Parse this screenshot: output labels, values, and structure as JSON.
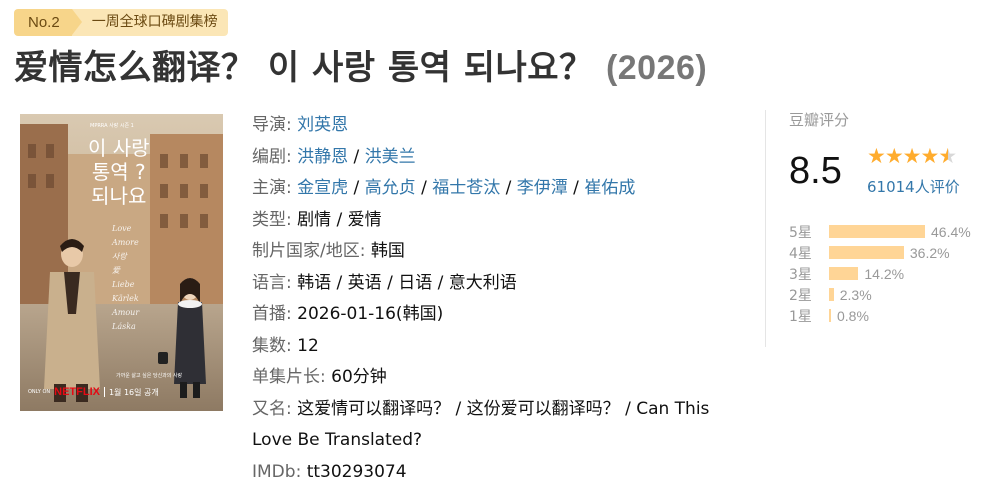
{
  "badge": {
    "rank": "No.2",
    "text": "一周全球口碑剧集榜"
  },
  "title": {
    "main": "爱情怎么翻译？ 이 사랑 통역 되나요？",
    "year": "(2026)"
  },
  "poster": {
    "top_text": "MPRRA 사랑 시즌 1",
    "korean_title": [
      "이 사랑",
      "통역 ?",
      "되나요"
    ],
    "script_words": [
      "Love",
      "Amore",
      "사랑",
      "爱",
      "Liebe",
      "Kärlek",
      "Amour",
      "Láska"
    ],
    "tagline": "가까운 삶고 싶은 당신과의 사랑",
    "only_on": "ONLY ON",
    "brand": "NETFLIX",
    "date": "1월 16일 공개"
  },
  "info": {
    "director_label": "导演:",
    "directors": [
      "刘英恩"
    ],
    "writer_label": "编剧:",
    "writers": [
      "洪静恩",
      "洪美兰"
    ],
    "cast_label": "主演:",
    "cast": [
      "金宣虎",
      "高允贞",
      "福士苍汰",
      "李伊潭",
      "崔佑成"
    ],
    "genre_label": "类型:",
    "genre": "剧情 / 爱情",
    "country_label": "制片国家/地区:",
    "country": "韩国",
    "language_label": "语言:",
    "language": "韩语 / 英语 / 日语 / 意大利语",
    "premiere_label": "首播:",
    "premiere": "2026-01-16(韩国)",
    "episodes_label": "集数:",
    "episodes": "12",
    "runtime_label": "单集片长:",
    "runtime": "60分钟",
    "aka_label": "又名:",
    "aka": "这爱情可以翻译吗？ / 这份爱可以翻译吗？ / Can This Love Be Translated?",
    "imdb_label": "IMDb:",
    "imdb": "tt30293074"
  },
  "rating": {
    "label": "豆瓣评分",
    "score": "8.5",
    "stars": 4.5,
    "count": "61014人评价",
    "distribution": [
      {
        "label": "5星",
        "pct": "46.4%",
        "value": 46.4
      },
      {
        "label": "4星",
        "pct": "36.2%",
        "value": 36.2
      },
      {
        "label": "3星",
        "pct": "14.2%",
        "value": 14.2
      },
      {
        "label": "2星",
        "pct": "2.3%",
        "value": 2.3
      },
      {
        "label": "1星",
        "pct": "0.8%",
        "value": 0.8
      }
    ],
    "bar_color": "#ffd596",
    "star_color": "#ffac2d"
  }
}
